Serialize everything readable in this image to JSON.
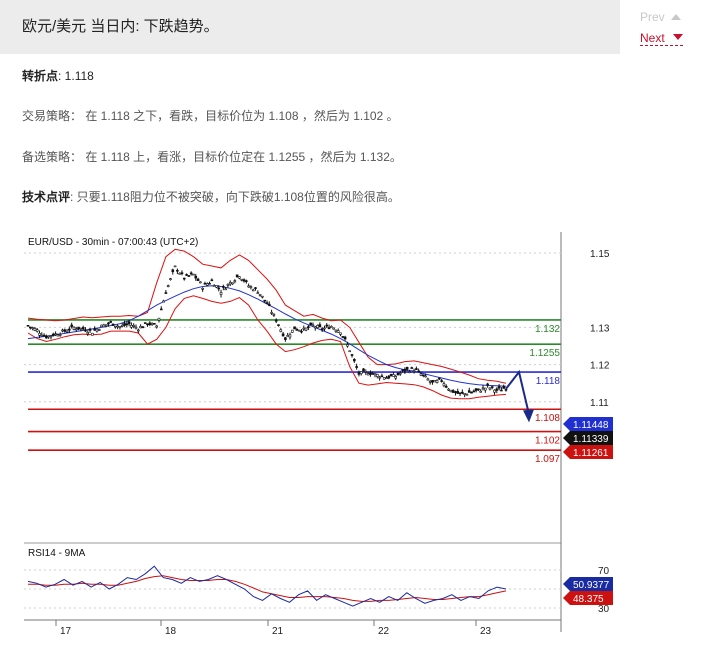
{
  "header": {
    "title": "欧元/美元 当日内: 下跌趋势。"
  },
  "nav": {
    "prev": "Prev",
    "next": "Next"
  },
  "analysis": {
    "pivot_label": "转折点",
    "pivot_value": ": 1.118",
    "strategy_label": "交易策略",
    "strategy_text": "： 在 1.118 之下，看跌，目标价位为 1.108 ，然后为 1.102 。",
    "alt_label": "备选策略",
    "alt_text": "： 在 1.118 上，看涨，目标价位定在 1.1255 ，然后为 1.132。",
    "comment_label": "技术点评",
    "comment_text": ": 只要1.118阻力位不被突破，向下跌破1.108位置的风险很高。"
  },
  "chart_data": {
    "type": "candlestick",
    "title": "EUR/USD - 30min - 07:00:43 (UTC+2)",
    "y_ticks": [
      1.15,
      1.13,
      1.12,
      1.11
    ],
    "ylim": [
      1.0935,
      1.1535
    ],
    "x_ticks": [
      "17",
      "18",
      "21",
      "22",
      "23"
    ],
    "levels": [
      {
        "value": 1.132,
        "label": "1.132",
        "color": "#2a8a2a"
      },
      {
        "value": 1.1255,
        "label": "1.1255",
        "color": "#2a8a2a"
      },
      {
        "value": 1.118,
        "label": "1.118",
        "color": "#2b2bd6"
      },
      {
        "value": 1.108,
        "label": "1.108",
        "color": "#cc1111"
      },
      {
        "value": 1.102,
        "label": "1.102",
        "color": "#cc1111"
      },
      {
        "value": 1.097,
        "label": "1.097",
        "color": "#cc1111"
      }
    ],
    "price_tags": [
      {
        "label": "1.11448",
        "value": 1.11448,
        "color": "#1f2fd0"
      },
      {
        "label": "1.11339",
        "value": 1.11339,
        "color": "#111111"
      },
      {
        "label": "1.11261",
        "value": 1.11261,
        "color": "#cc1111"
      }
    ],
    "close_path": [
      1.1305,
      1.1292,
      1.1275,
      1.1282,
      1.129,
      1.13,
      1.1296,
      1.1288,
      1.1303,
      1.1312,
      1.1302,
      1.1309,
      1.1298,
      1.1311,
      1.1304,
      1.1395,
      1.1462,
      1.1434,
      1.1442,
      1.141,
      1.1425,
      1.1398,
      1.142,
      1.1441,
      1.1412,
      1.1398,
      1.1365,
      1.132,
      1.127,
      1.1298,
      1.1293,
      1.1305,
      1.1296,
      1.1303,
      1.129,
      1.124,
      1.1175,
      1.118,
      1.1172,
      1.1166,
      1.1169,
      1.1185,
      1.1188,
      1.117,
      1.115,
      1.1158,
      1.113,
      1.112,
      1.1125,
      1.113,
      1.114,
      1.1131,
      1.1138
    ],
    "bb_upper": [
      1.1325,
      1.1322,
      1.132,
      1.1318,
      1.132,
      1.1324,
      1.1328,
      1.1326,
      1.1328,
      1.133,
      1.133,
      1.1332,
      1.133,
      1.134,
      1.142,
      1.149,
      1.151,
      1.1505,
      1.149,
      1.147,
      1.1465,
      1.146,
      1.148,
      1.1495,
      1.148,
      1.1455,
      1.143,
      1.14,
      1.136,
      1.1345,
      1.133,
      1.1335,
      1.1325,
      1.1318,
      1.132,
      1.13,
      1.126,
      1.122,
      1.12,
      1.12,
      1.1202,
      1.1208,
      1.121,
      1.1205,
      1.12,
      1.1195,
      1.1188,
      1.118,
      1.1172,
      1.1162,
      1.1158,
      1.1155,
      1.115
    ],
    "bb_lower": [
      1.1285,
      1.127,
      1.1262,
      1.1268,
      1.1275,
      1.128,
      1.1282,
      1.128,
      1.1282,
      1.129,
      1.129,
      1.129,
      1.1285,
      1.1255,
      1.1268,
      1.13,
      1.135,
      1.1378,
      1.1385,
      1.1378,
      1.137,
      1.1365,
      1.137,
      1.138,
      1.136,
      1.132,
      1.129,
      1.1255,
      1.1235,
      1.124,
      1.1248,
      1.1258,
      1.1265,
      1.1268,
      1.1262,
      1.1195,
      1.115,
      1.1145,
      1.1148,
      1.1152,
      1.115,
      1.1148,
      1.1146,
      1.114,
      1.113,
      1.1118,
      1.111,
      1.1108,
      1.1108,
      1.1112,
      1.1115,
      1.1118,
      1.112
    ],
    "ma_blue": [
      1.127,
      1.1273,
      1.1276,
      1.128,
      1.1284,
      1.1288,
      1.1292,
      1.1296,
      1.13,
      1.1305,
      1.131,
      1.1318,
      1.133,
      1.1345,
      1.136,
      1.1372,
      1.1384,
      1.1395,
      1.1404,
      1.141,
      1.1412,
      1.141,
      1.1405,
      1.1398,
      1.1388,
      1.1376,
      1.1363,
      1.135,
      1.1336,
      1.1323,
      1.1312,
      1.1302,
      1.1292,
      1.1282,
      1.127,
      1.1256,
      1.124,
      1.1225,
      1.1212,
      1.12,
      1.1192,
      1.1186,
      1.1182,
      1.1176,
      1.117,
      1.1164,
      1.1158,
      1.1153,
      1.1149,
      1.1146,
      1.1144,
      1.1143,
      1.1142
    ],
    "forecast": {
      "from": 1.1135,
      "peak": 1.118,
      "to": 1.105
    },
    "rsi": {
      "title": "RSI14 - 9MA",
      "y_ticks": [
        70,
        50,
        30
      ],
      "rsi_value": "50.9377",
      "ma_value": "48.375",
      "rsi_series": [
        58,
        56,
        52,
        55,
        60,
        54,
        58,
        52,
        57,
        50,
        55,
        62,
        60,
        66,
        74,
        62,
        60,
        56,
        62,
        58,
        60,
        64,
        60,
        55,
        50,
        42,
        38,
        45,
        40,
        36,
        44,
        48,
        38,
        44,
        40,
        36,
        32,
        36,
        40,
        36,
        42,
        38,
        46,
        40,
        35,
        38,
        40,
        44,
        38,
        42,
        40,
        48,
        52,
        50
      ],
      "ma_series": [
        55,
        55,
        54,
        54,
        55,
        55,
        56,
        55,
        55,
        54,
        54,
        56,
        58,
        61,
        63,
        64,
        62,
        60,
        59,
        59,
        59,
        60,
        60,
        58,
        55,
        51,
        47,
        45,
        43,
        41,
        41,
        42,
        42,
        42,
        41,
        40,
        38,
        37,
        37,
        38,
        38,
        39,
        40,
        41,
        40,
        39,
        39,
        40,
        41,
        42,
        42,
        44,
        46,
        48
      ]
    }
  }
}
